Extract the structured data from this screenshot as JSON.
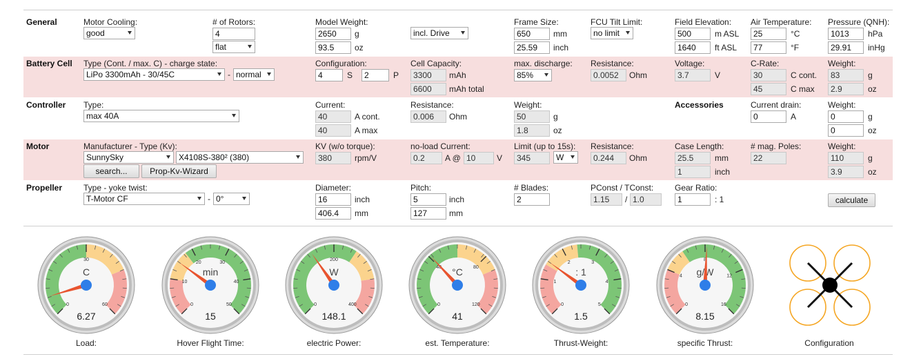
{
  "general": {
    "title": "General",
    "motor_cooling_label": "Motor Cooling:",
    "motor_cooling_value": "good",
    "rotors_label": "# of Rotors:",
    "rotors_value": "4",
    "rotors_layout": "flat",
    "model_weight_label": "Model Weight:",
    "model_weight_g": "2650",
    "model_weight_oz": "93.5",
    "unit_g": "g",
    "unit_oz": "oz",
    "drive_option": "incl. Drive",
    "frame_size_label": "Frame Size:",
    "frame_size_mm": "650",
    "frame_size_inch": "25.59",
    "unit_mm": "mm",
    "unit_inch": "inch",
    "fcu_tilt_label": "FCU Tilt Limit:",
    "fcu_tilt_value": "no limit",
    "field_elev_label": "Field Elevation:",
    "field_elev_m": "500",
    "field_elev_ft": "1640",
    "unit_m_asl": "m ASL",
    "unit_ft_asl": "ft ASL",
    "air_temp_label": "Air Temperature:",
    "air_temp_c": "25",
    "air_temp_f": "77",
    "unit_c": "°C",
    "unit_f": "°F",
    "pressure_label": "Pressure (QNH):",
    "pressure_hpa": "1013",
    "pressure_inhg": "29.91",
    "unit_hpa": "hPa",
    "unit_inhg": "inHg"
  },
  "battery": {
    "title": "Battery Cell",
    "type_label": "Type (Cont. / max. C) - charge state:",
    "type_value": "LiPo 3300mAh - 30/45C",
    "dash": "-",
    "charge_state": "normal",
    "config_label": "Configuration:",
    "config_s": "4",
    "unit_s": "S",
    "config_p": "2",
    "unit_p": "P",
    "capacity_label": "Cell Capacity:",
    "capacity_mah": "3300",
    "capacity_total": "6600",
    "unit_mah": "mAh",
    "unit_mah_total": "mAh total",
    "max_discharge_label": "max. discharge:",
    "max_discharge_value": "85%",
    "resistance_label": "Resistance:",
    "resistance_value": "0.0052",
    "unit_ohm": "Ohm",
    "voltage_label": "Voltage:",
    "voltage_value": "3.7",
    "unit_v": "V",
    "crate_label": "C-Rate:",
    "crate_cont": "30",
    "crate_max": "45",
    "unit_c_cont": "C cont.",
    "unit_c_max": "C max",
    "weight_label": "Weight:",
    "weight_g": "83",
    "weight_oz": "2.9",
    "unit_g": "g",
    "unit_oz": "oz"
  },
  "controller": {
    "title": "Controller",
    "type_label": "Type:",
    "type_value": "max 40A",
    "current_label": "Current:",
    "current_cont": "40",
    "current_max": "40",
    "unit_a_cont": "A cont.",
    "unit_a_max": "A max",
    "resistance_label": "Resistance:",
    "resistance_value": "0.006",
    "unit_ohm": "Ohm",
    "weight_label": "Weight:",
    "weight_g": "50",
    "weight_oz": "1.8",
    "unit_g": "g",
    "unit_oz": "oz",
    "accessories_title": "Accessories",
    "current_drain_label": "Current drain:",
    "current_drain_value": "0",
    "unit_a": "A",
    "acc_weight_label": "Weight:",
    "acc_weight_g": "0",
    "acc_weight_oz": "0"
  },
  "motor": {
    "title": "Motor",
    "manufacturer_label": "Manufacturer - Type (Kv):",
    "manufacturer_value": "SunnySky",
    "type_value": "X4108S-380² (380)",
    "search_button": "search...",
    "wizard_button": "Prop-Kv-Wizard",
    "kv_label": "KV (w/o torque):",
    "kv_value": "380",
    "unit_rpmv": "rpm/V",
    "noload_label": "no-load Current:",
    "noload_a": "0.2",
    "unit_a_at": "A @",
    "noload_v": "10",
    "unit_v": "V",
    "limit_label": "Limit (up to 15s):",
    "limit_value": "345",
    "limit_unit": "W",
    "resistance_label": "Resistance:",
    "resistance_value": "0.244",
    "unit_ohm": "Ohm",
    "case_length_label": "Case Length:",
    "case_length_mm": "25.5",
    "case_length_inch": "1",
    "unit_mm": "mm",
    "unit_inch": "inch",
    "poles_label": "# mag. Poles:",
    "poles_value": "22",
    "weight_label": "Weight:",
    "weight_g": "110",
    "weight_oz": "3.9",
    "unit_g": "g",
    "unit_oz": "oz"
  },
  "propeller": {
    "title": "Propeller",
    "type_label": "Type - yoke twist:",
    "type_value": "T-Motor CF",
    "dash": "-",
    "twist_value": "0°",
    "diameter_label": "Diameter:",
    "diameter_inch": "16",
    "diameter_mm": "406.4",
    "unit_inch": "inch",
    "unit_mm": "mm",
    "pitch_label": "Pitch:",
    "pitch_inch": "5",
    "pitch_mm": "127",
    "blades_label": "# Blades:",
    "blades_value": "2",
    "pconst_label": "PConst / TConst:",
    "pconst_value": "1.15",
    "slash": "/",
    "tconst_value": "1.0",
    "gear_ratio_label": "Gear Ratio:",
    "gear_ratio_value": "1",
    "gear_ratio_unit": ": 1",
    "calculate_button": "calculate"
  },
  "gauges": [
    {
      "caption": "Load:",
      "unit": "C",
      "value": "6.27",
      "min": 0,
      "max": 60,
      "reading": 6.27,
      "ticks": [
        "0",
        "30",
        "60"
      ],
      "tick_values": [
        0,
        30,
        60
      ],
      "zones": [
        {
          "from": 0,
          "to": 30,
          "color": "#7cc576"
        },
        {
          "from": 30,
          "to": 45,
          "color": "#fbd38d"
        },
        {
          "from": 45,
          "to": 60,
          "color": "#f4a6a0"
        }
      ]
    },
    {
      "caption": "Hover Flight Time:",
      "unit": "min",
      "value": "15",
      "min": 0,
      "max": 50,
      "reading": 15,
      "ticks": [
        "0",
        "10",
        "20",
        "30",
        "40",
        "50"
      ],
      "tick_values": [
        0,
        10,
        20,
        30,
        40,
        50
      ],
      "zones": [
        {
          "from": 0,
          "to": 10,
          "color": "#f4a6a0"
        },
        {
          "from": 10,
          "to": 18,
          "color": "#fbd38d"
        },
        {
          "from": 18,
          "to": 50,
          "color": "#7cc576"
        }
      ]
    },
    {
      "caption": "electric Power:",
      "unit": "W",
      "value": "148.1",
      "min": 0,
      "max": 400,
      "reading": 148.1,
      "ticks": [
        "0",
        "200",
        "400"
      ],
      "tick_values": [
        0,
        200,
        400
      ],
      "zones": [
        {
          "from": 0,
          "to": 250,
          "color": "#7cc576"
        },
        {
          "from": 250,
          "to": 320,
          "color": "#fbd38d"
        },
        {
          "from": 320,
          "to": 400,
          "color": "#f4a6a0"
        }
      ]
    },
    {
      "caption": "est. Temperature:",
      "unit": "°C",
      "value": "41",
      "min": 0,
      "max": 120,
      "reading": 41,
      "ticks": [
        "0",
        "40",
        "80",
        "120"
      ],
      "tick_values": [
        0,
        40,
        80,
        120
      ],
      "zones": [
        {
          "from": 0,
          "to": 60,
          "color": "#7cc576"
        },
        {
          "from": 60,
          "to": 90,
          "color": "#fbd38d"
        },
        {
          "from": 90,
          "to": 120,
          "color": "#f4a6a0"
        }
      ]
    },
    {
      "caption": "Thrust-Weight:",
      "unit": ": 1",
      "value": "1.5",
      "min": 0,
      "max": 5,
      "reading": 1.5,
      "ticks": [
        "0",
        "1",
        "2",
        "3",
        "4",
        "5"
      ],
      "tick_values": [
        0,
        1,
        2,
        3,
        4,
        5
      ],
      "zones": [
        {
          "from": 0,
          "to": 1.4,
          "color": "#f4a6a0"
        },
        {
          "from": 1.4,
          "to": 2.4,
          "color": "#fbd38d"
        },
        {
          "from": 2.4,
          "to": 5,
          "color": "#7cc576"
        }
      ]
    },
    {
      "caption": "specific Thrust:",
      "unit": "g/W",
      "value": "8.15",
      "min": 0,
      "max": 16,
      "reading": 8.15,
      "ticks": [
        "0",
        "4",
        "8",
        "12",
        "16"
      ],
      "tick_values": [
        0,
        4,
        8,
        12,
        16
      ],
      "zones": [
        {
          "from": 0,
          "to": 4,
          "color": "#f4a6a0"
        },
        {
          "from": 4,
          "to": 6,
          "color": "#fbd38d"
        },
        {
          "from": 6,
          "to": 16,
          "color": "#7cc576"
        }
      ]
    }
  ],
  "configuration": {
    "caption": "Configuration",
    "rotor_color": "#f5a623"
  }
}
